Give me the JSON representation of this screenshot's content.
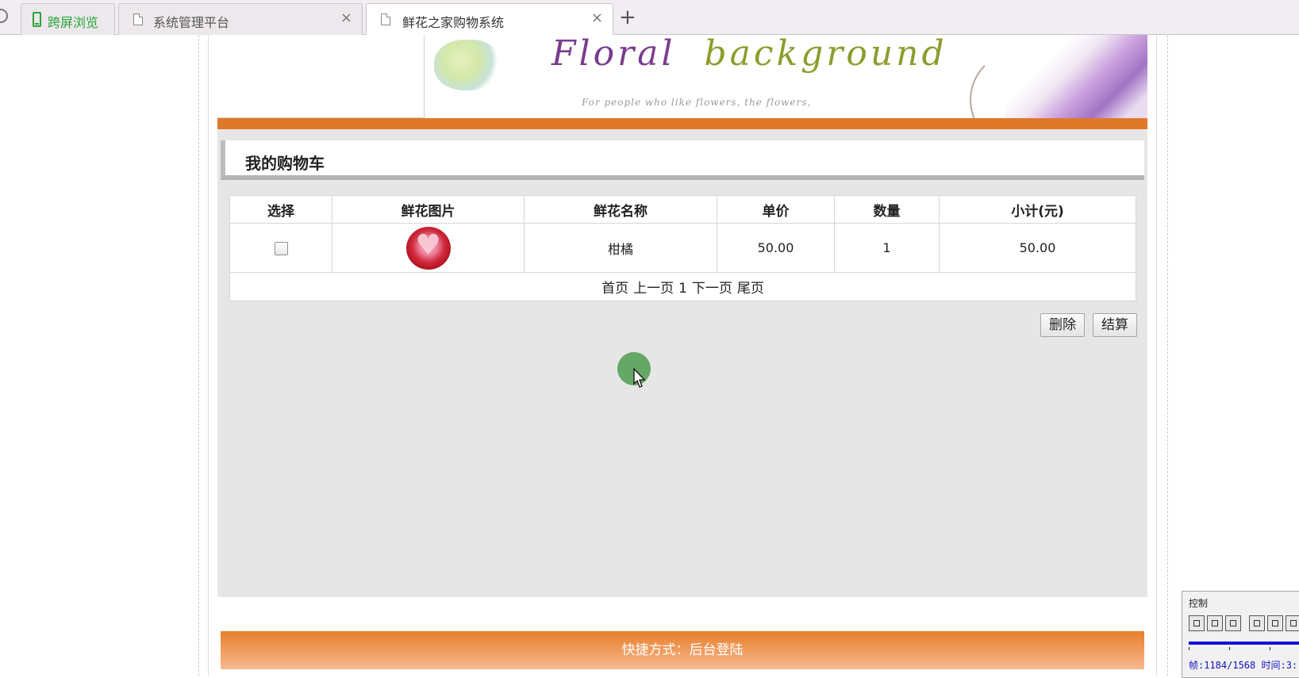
{
  "browser": {
    "tabs": [
      {
        "label": "跨屏浏览"
      },
      {
        "label": "系统管理平台"
      },
      {
        "label": "鲜花之家购物系统"
      }
    ],
    "close_symbol": "×",
    "newtab_symbol": "+"
  },
  "banner": {
    "title_part1": "Floral",
    "title_part2": "background",
    "subtitle": "For people who like flowers, the flowers,"
  },
  "cart": {
    "title": "我的购物车",
    "columns": [
      "选择",
      "鲜花图片",
      "鲜花名称",
      "单价",
      "数量",
      "小计(元)"
    ],
    "rows": [
      {
        "name": "柑橘",
        "unit_price": "50.00",
        "quantity": "1",
        "subtotal": "50.00"
      }
    ],
    "pager": {
      "first": "首页",
      "prev": "上一页",
      "page": "1",
      "next": "下一页",
      "last": "尾页"
    },
    "buttons": {
      "delete": "删除",
      "checkout": "结算"
    }
  },
  "footer": {
    "text": "快捷方式：后台登陆"
  },
  "control": {
    "title": "控制",
    "status": "帧:1184/1568 时间:3:"
  },
  "colors": {
    "accent_orange": "#e0782a",
    "tab_green": "#2aa53a",
    "content_bg": "#e6e6e6"
  }
}
